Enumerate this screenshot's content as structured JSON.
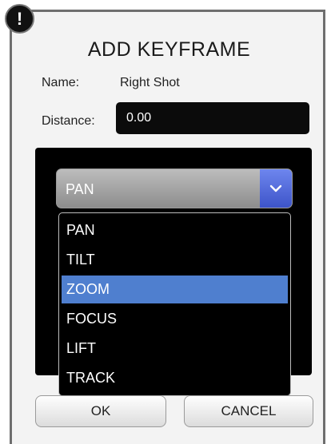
{
  "dialog": {
    "title": "ADD KEYFRAME",
    "badge_symbol": "!",
    "name_label": "Name:",
    "name_value": "Right Shot",
    "distance_label": "Distance:",
    "distance_value": "0.00"
  },
  "combo": {
    "selected": "PAN",
    "options": [
      "PAN",
      "TILT",
      "ZOOM",
      "FOCUS",
      "LIFT",
      "TRACK"
    ],
    "highlighted": "ZOOM"
  },
  "buttons": {
    "ok_label": "OK",
    "cancel_label": "CANCEL"
  },
  "colors": {
    "highlight": "#4f7fcf",
    "dropdown_arrow": "#3d54c9"
  }
}
